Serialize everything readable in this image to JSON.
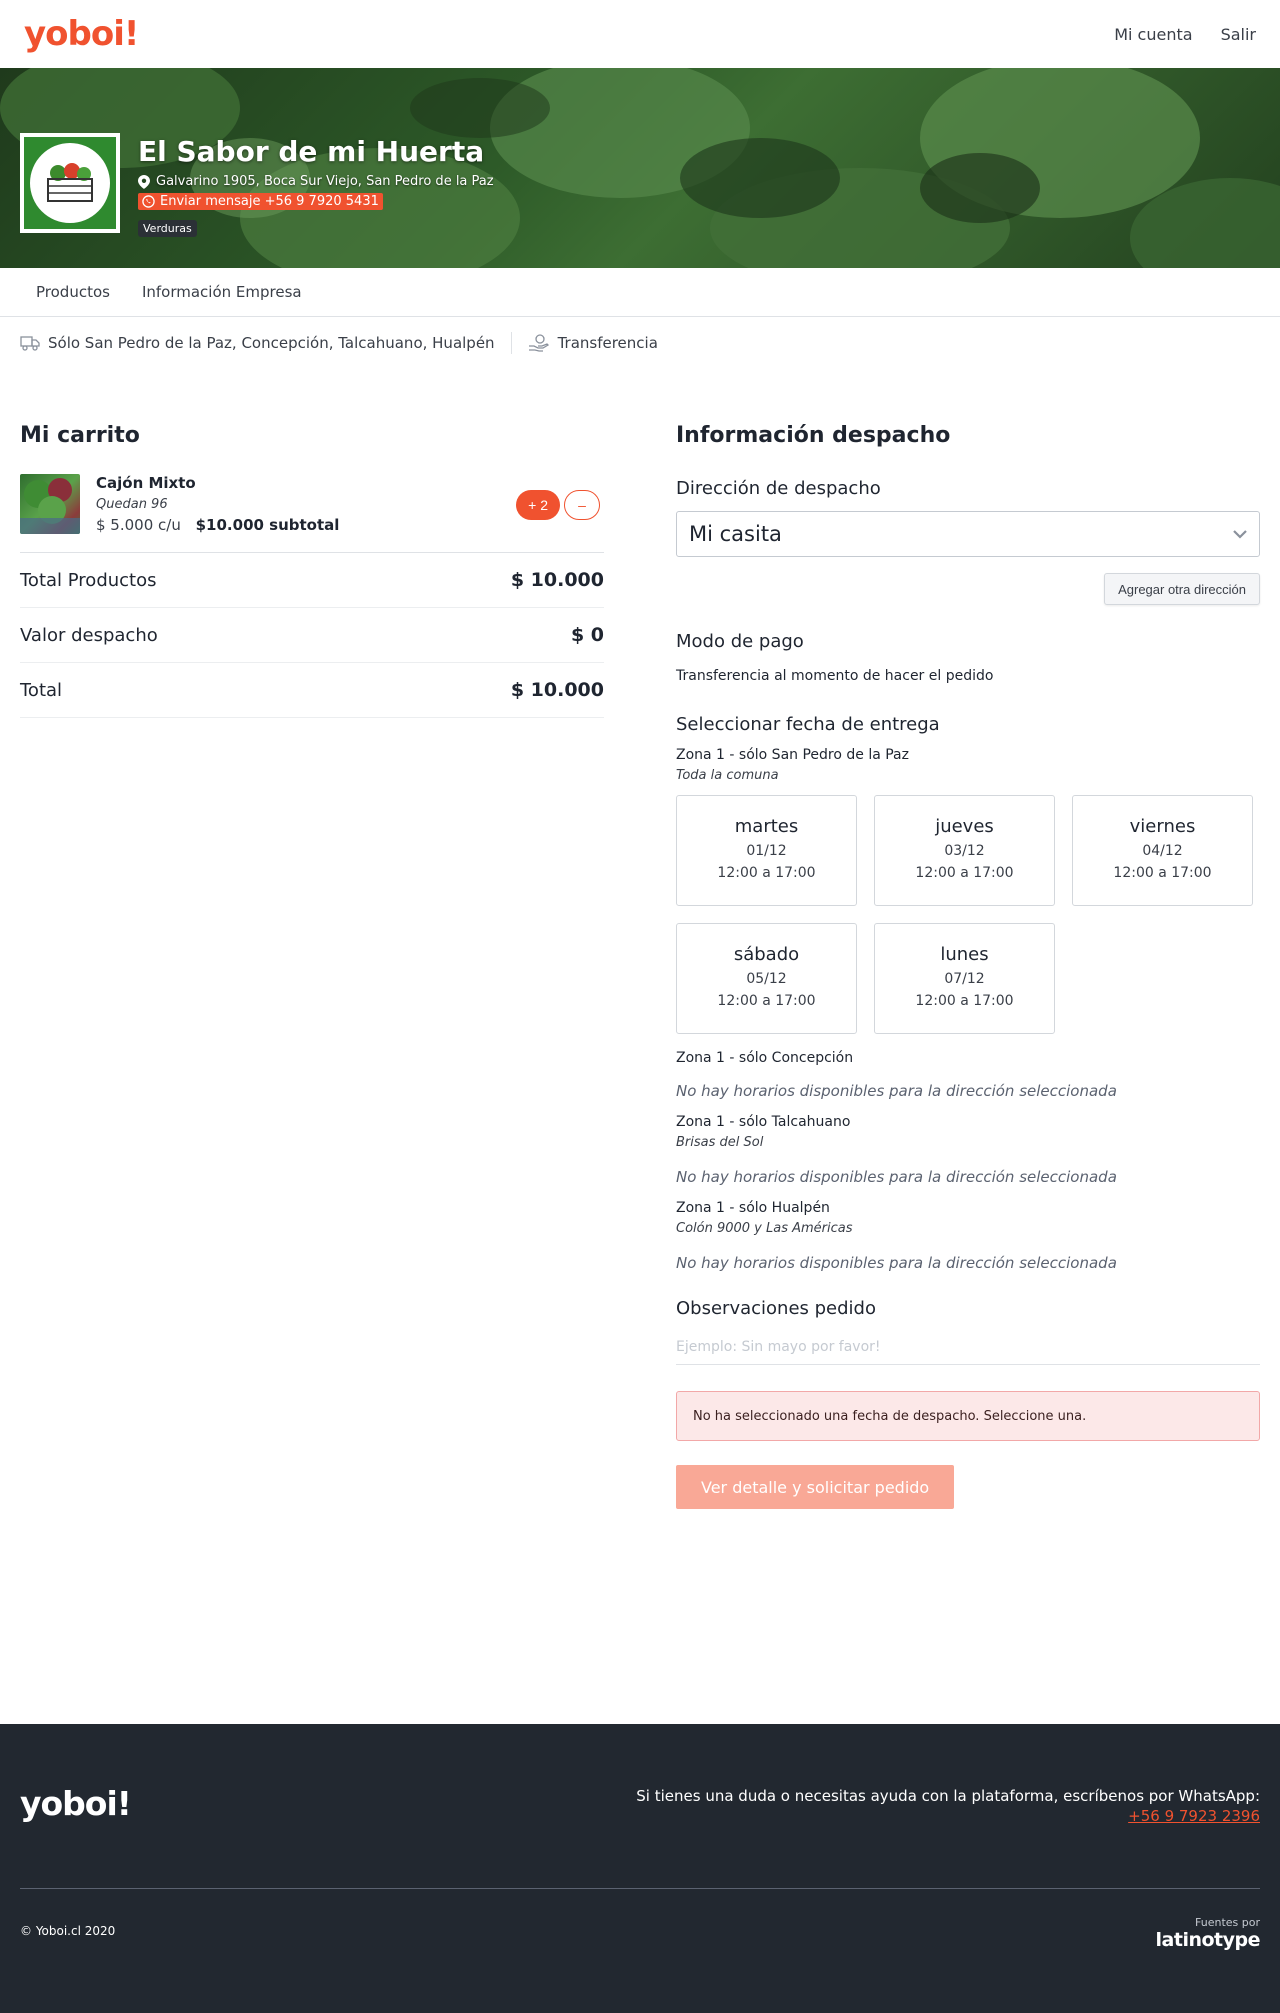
{
  "brand": {
    "logo": "yoboi!",
    "accent": "#f0522f"
  },
  "topnav": {
    "account": "Mi cuenta",
    "logout": "Salir"
  },
  "store": {
    "name": "El Sabor de mi Huerta",
    "address": "Galvarino 1905, Boca Sur Viejo, San Pedro de la Paz",
    "whatsapp": "Enviar mensaje +56 9 7920 5431",
    "category": "Verduras"
  },
  "tabs": [
    "Productos",
    "Información Empresa"
  ],
  "infobar": {
    "delivery": "Sólo San Pedro de la Paz, Concepción, Talcahuano, Hualpén",
    "payment": "Transferencia"
  },
  "cart": {
    "title": "Mi carrito",
    "item": {
      "name": "Cajón Mixto",
      "stock": "Quedan 96",
      "unit_price": "$ 5.000 c/u",
      "subtotal": "$10.000 subtotal",
      "qty_plus": "+ 2",
      "qty_minus": "–"
    },
    "totals": [
      {
        "label": "Total Productos",
        "value": "$ 10.000"
      },
      {
        "label": "Valor despacho",
        "value": "$ 0"
      },
      {
        "label": "Total",
        "value": "$ 10.000"
      }
    ]
  },
  "shipping": {
    "title": "Información despacho",
    "address_label": "Dirección de despacho",
    "address_value": "Mi casita",
    "add_address": "Agregar otra dirección",
    "payment_label": "Modo de pago",
    "payment_text": "Transferencia al momento de hacer el pedido",
    "date_label": "Seleccionar fecha de entrega",
    "zones": [
      {
        "title": "Zona 1 - sólo San Pedro de la Paz",
        "subtitle": "Toda la comuna",
        "slots": [
          {
            "day": "martes",
            "date": "01/12",
            "time": "12:00 a 17:00"
          },
          {
            "day": "jueves",
            "date": "03/12",
            "time": "12:00 a 17:00"
          },
          {
            "day": "viernes",
            "date": "04/12",
            "time": "12:00 a 17:00"
          },
          {
            "day": "sábado",
            "date": "05/12",
            "time": "12:00 a 17:00"
          },
          {
            "day": "lunes",
            "date": "07/12",
            "time": "12:00 a 17:00"
          }
        ]
      },
      {
        "title": "Zona 1 - sólo Concepción",
        "subtitle": "",
        "no_slots": "No hay horarios disponibles para la dirección seleccionada"
      },
      {
        "title": "Zona 1 - sólo Talcahuano",
        "subtitle": "Brisas del Sol",
        "no_slots": "No hay horarios disponibles para la dirección seleccionada"
      },
      {
        "title": "Zona 1 - sólo Hualpén",
        "subtitle": "Colón 9000 y Las Américas",
        "no_slots": "No hay horarios disponibles para la dirección seleccionada"
      }
    ],
    "notes_label": "Observaciones pedido",
    "notes_placeholder": "Ejemplo: Sin mayo por favor!",
    "alert": "No ha seleccionado una fecha de despacho. Seleccione una.",
    "submit": "Ver detalle y solicitar pedido"
  },
  "footer": {
    "logo": "yoboi!",
    "help_text": "Si tienes una duda o necesitas ayuda con la plataforma, escríbenos por WhatsApp:",
    "help_phone": "+56 9 7923 2396",
    "copyright": "© Yoboi.cl 2020",
    "fonts_label": "Fuentes por",
    "fonts_brand": "latinotype"
  }
}
